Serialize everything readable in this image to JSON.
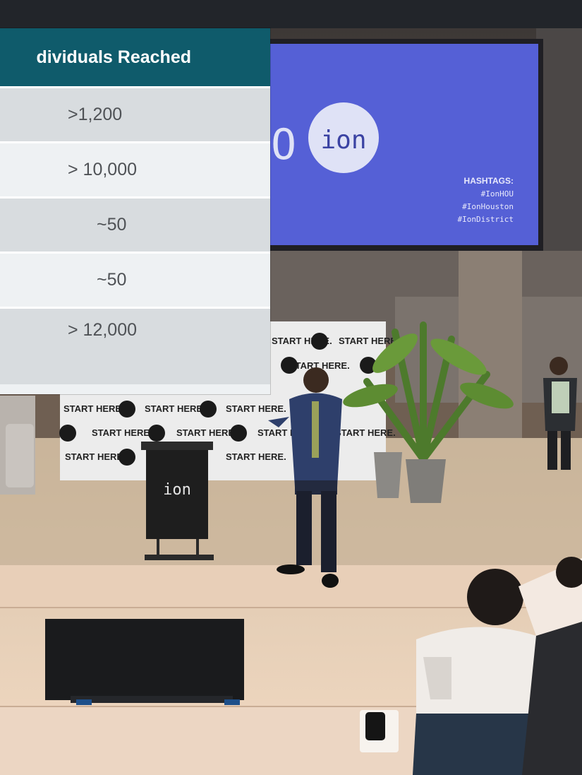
{
  "table": {
    "header": "dividuals Reached",
    "rows": [
      ">1,200",
      "> 10,000",
      "~50",
      "~50",
      "> 12,000"
    ]
  },
  "photo": {
    "screen_logo": "ion",
    "screen_partial_glyph": "O",
    "hashtags_title": "HASHTAGS:",
    "hashtags": [
      "#IonHOU",
      "#IonHouston",
      "#IonDistrict"
    ],
    "backdrop_text": "START HERE.",
    "backdrop_logo": "ion",
    "podium_logo": "ion"
  },
  "colors": {
    "screen_blue": "#5560d6",
    "table_header": "#0f5b6b",
    "table_text": "#4f5256"
  }
}
